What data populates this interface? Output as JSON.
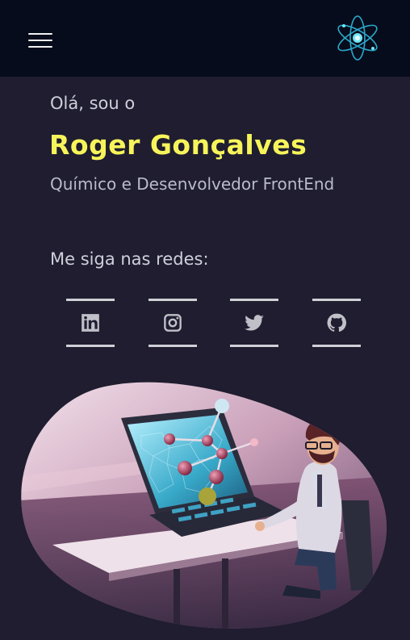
{
  "header": {
    "menu_icon": "hamburger-menu-icon",
    "logo_icon": "atom-logo-icon"
  },
  "intro": {
    "greeting": "Olá, sou o",
    "name": "Roger Gonçalves",
    "role": "Químico e Desenvolvedor FrontEnd"
  },
  "social": {
    "heading": "Me siga nas redes:",
    "links": [
      {
        "icon": "linkedin-icon"
      },
      {
        "icon": "instagram-icon"
      },
      {
        "icon": "twitter-icon"
      },
      {
        "icon": "github-icon"
      }
    ]
  },
  "colors": {
    "background": "#1f1d2f",
    "topbar": "#070c1c",
    "name_accent": "#f7f45b",
    "logo_accent": "#3ad0e6"
  }
}
